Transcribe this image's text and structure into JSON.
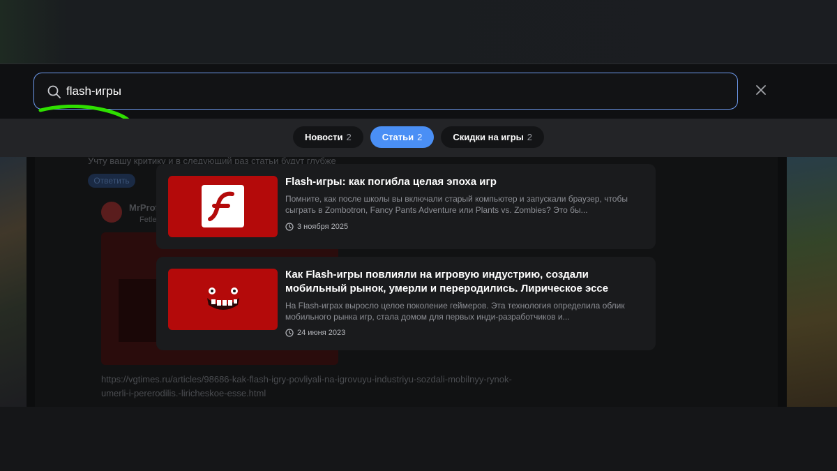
{
  "search": {
    "query": "flash-игры"
  },
  "tabs": [
    {
      "label": "Новости",
      "count": "2"
    },
    {
      "label": "Статьи",
      "count": "2"
    },
    {
      "label": "Скидки на игры",
      "count": "2"
    }
  ],
  "results": [
    {
      "title": "Flash-игры: как погибла целая эпоха игр",
      "description": "Помните, как после школы вы включали старый компьютер и запускали браузер, чтобы сыграть в Zombotron, Fancy Pants Adventure или Plants vs. Zombies? Это бы...",
      "date": "3 ноября 2025",
      "thumb_icon": "flash-player-logo-icon"
    },
    {
      "title": "Как Flash-игры повлияли на игровую индустрию, создали мобильный рынок, умерли и переродились. Лирическое эссе",
      "description": "На Flash-играх выросло целое поколение геймеров. Эта технология определила облик мобильного рынка игр, стала домом для первых инди-разработчиков и...",
      "date": "24 июня 2023",
      "thumb_icon": "super-meat-boy-face-icon"
    }
  ],
  "background": {
    "comment_line": "Учту вашу критику и в следующий раз статьи будут глубже",
    "reply_label": "Ответить",
    "author": "MrProf",
    "author_sub": "Fetle",
    "link_line_1": "https://vgtimes.ru/articles/98686-kak-flash-igry-povliyali-na-igrovuyu-industriyu-sozdali-mobilnyy-rynok-",
    "link_line_2": "umerli-i-pererodilis.-liricheskoe-esse.html"
  },
  "colors": {
    "accent": "#4a8ff5",
    "search_border": "#6f9cf0",
    "thumb_red": "#b40a0a",
    "annotation_green": "#2fe000"
  }
}
